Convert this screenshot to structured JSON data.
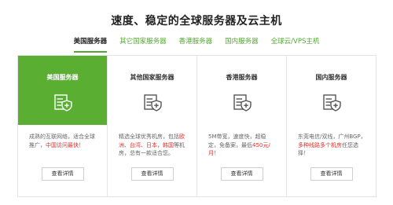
{
  "header": {
    "title": "速度、稳定的全球服务器及云主机"
  },
  "tabs": [
    {
      "label": "美国服务器",
      "active": true
    },
    {
      "label": "其它国家服务器",
      "active": false
    },
    {
      "label": "香港服务器",
      "active": false
    },
    {
      "label": "国内服务器",
      "active": false
    },
    {
      "label": "全球云/VPS主机",
      "active": false
    }
  ],
  "cards": [
    {
      "title": "美国服务器",
      "icon": "server-shield-icon",
      "desc_parts": [
        {
          "text": "成熟的互联网络，适合全球推广，"
        },
        {
          "text": "中国访问最快！",
          "highlight": true
        }
      ],
      "button": "查看详情"
    },
    {
      "title": "其他国家服务器",
      "icon": "server-shield-icon",
      "desc_parts": [
        {
          "text": "精选全球优秀机房，包括"
        },
        {
          "text": "欧洲、台湾、日本，韩国",
          "highlight": true
        },
        {
          "text": "等机房，总有一款适合您。"
        }
      ],
      "button": "查看详情"
    },
    {
      "title": "香港服务器",
      "icon": "server-shield-icon",
      "desc_parts": [
        {
          "text": "5M带宽，速度快，超稳定，免备案，最低"
        },
        {
          "text": "450元/月！",
          "highlight": true
        }
      ],
      "button": "查看详情"
    },
    {
      "title": "国内服务器",
      "icon": "server-shield-icon",
      "desc_parts": [
        {
          "text": "东莞电信/双线，广州BGP，"
        },
        {
          "text": "多种线路多个机房",
          "highlight": true
        },
        {
          "text": "任您选择！"
        }
      ],
      "button": "查看详情"
    }
  ],
  "colors": {
    "accent": "#5aaf33",
    "highlight": "#e0312a",
    "tab_text": "#54a734"
  }
}
